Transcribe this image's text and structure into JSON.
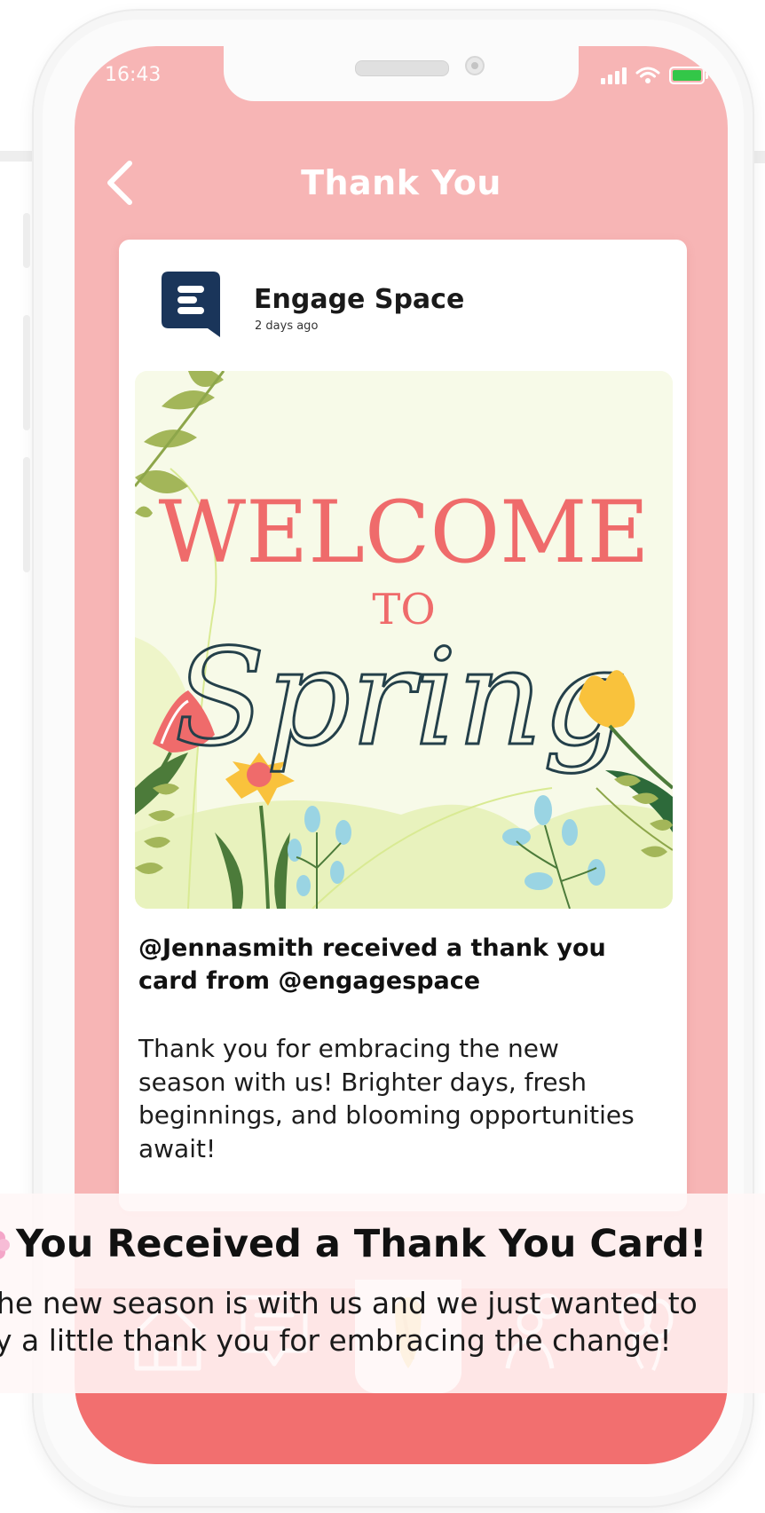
{
  "status_bar": {
    "time": "16:43"
  },
  "header": {
    "title": "Thank You"
  },
  "card": {
    "author_name": "Engage Space",
    "posted_ago": "2 days ago",
    "artwork": {
      "line1": "WELCOME",
      "line2": "TO",
      "line3": "Spring"
    },
    "heading": "@Jennasmith received a thank you card from @engagespace",
    "body": "Thank you for embracing the new season with us! Brighter days, fresh beginnings, and blooming opportunities await!"
  },
  "notification": {
    "title": "You Received a Thank You Card!",
    "line1": "he new season is with us and we just wanted to",
    "line2": "y a little thank you for embracing the change!"
  },
  "bottom_nav": {
    "items": [
      {
        "icon": "home-icon"
      },
      {
        "icon": "feed-icon"
      },
      {
        "icon": "thank-you-icon",
        "active": true
      },
      {
        "icon": "people-icon"
      },
      {
        "icon": "celebrate-icon"
      }
    ]
  },
  "colors": {
    "screen_bg": "#f7b5b5",
    "nav_bg": "#f26f6f",
    "brand_navy": "#1a355a",
    "welcome_red": "#ef6b6b",
    "script_dark": "#24404a"
  }
}
